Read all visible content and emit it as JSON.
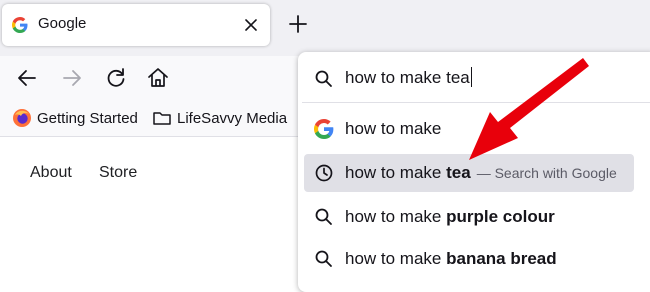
{
  "browser": {
    "tab": {
      "title": "Google",
      "favicon": "google-g-icon"
    },
    "new_tab_icon": "plus-icon",
    "nav": {
      "back": "back-arrow-icon",
      "forward": "forward-arrow-icon",
      "reload": "reload-icon",
      "home": "home-icon"
    },
    "bookmarks": [
      {
        "label": "Getting Started",
        "icon": "firefox-icon"
      },
      {
        "label": "LifeSavvy Media",
        "icon": "folder-icon"
      }
    ]
  },
  "page": {
    "links": [
      {
        "label": "About"
      },
      {
        "label": "Store"
      }
    ]
  },
  "address_bar": {
    "value": "how to make tea",
    "icon": "search-icon"
  },
  "suggestions": [
    {
      "prefix": "how to make",
      "bold": "",
      "action": "",
      "icon": "google-g-icon",
      "selected": false
    },
    {
      "prefix": "how to make ",
      "bold": "tea",
      "action": "— Search with Google",
      "icon": "history-clock-icon",
      "selected": true
    },
    {
      "prefix": "how to make ",
      "bold": "purple colour",
      "action": "",
      "icon": "search-icon",
      "selected": false
    },
    {
      "prefix": "how to make ",
      "bold": "banana bread",
      "action": "",
      "icon": "search-icon",
      "selected": false
    }
  ],
  "annotation": {
    "arrow_color": "#e8000b"
  },
  "colors": {
    "tabstrip": "#f0f0f4",
    "toolbar": "#f9f9fb",
    "selected_row": "#e0e0e6"
  }
}
